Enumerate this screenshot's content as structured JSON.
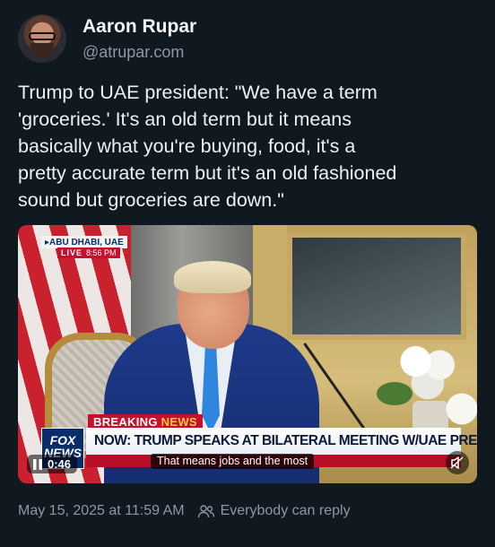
{
  "author": {
    "display_name": "Aaron Rupar",
    "handle": "@atrupar.com"
  },
  "post": {
    "text": "Trump to UAE president: \"We have a term\n'groceries.' It's an old term but it means\nbasically what you're buying, food, it's a\npretty accurate term but it's an old fashioned\nsound but groceries are down.\""
  },
  "video": {
    "location_tag": "▸ABU DHABI, UAE",
    "live_label": "LIVE",
    "live_time": "8:56 PM",
    "breaking_label": "BREAKING",
    "breaking_news": "NEWS",
    "network_line1": "FOX",
    "network_line2": "NEWS",
    "headline": "NOW: TRUMP SPEAKS AT BILATERAL MEETING W/UAE PRES",
    "caption": "That means jobs and the most",
    "duration": "0:46"
  },
  "footer": {
    "timestamp": "May 15, 2025 at 11:59 AM",
    "reply_setting": "Everybody can reply"
  },
  "icons": {
    "pause": "pause-icon",
    "mute": "mute-icon",
    "people": "people-icon"
  },
  "colors": {
    "background": "#101820",
    "secondary_text": "#8e96a3",
    "fox_red": "#c8102e",
    "fox_blue": "#0b2c6b"
  }
}
